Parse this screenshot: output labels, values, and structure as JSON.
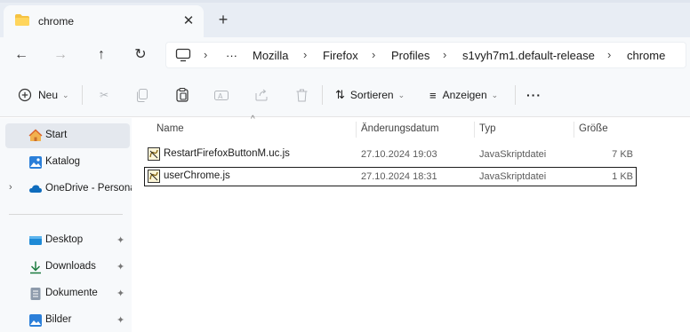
{
  "tab": {
    "title": "chrome",
    "close": "✕",
    "new": "+"
  },
  "nav": {
    "back": "←",
    "forward": "→",
    "up": "↑",
    "refresh": "↻"
  },
  "address": {
    "overflow": "···",
    "crumbs": [
      "Mozilla",
      "Firefox",
      "Profiles",
      "s1vyh7m1.default-release",
      "chrome"
    ],
    "separator": "›"
  },
  "commands": {
    "new_label": "Neu",
    "sort_label": "Sortieren",
    "view_label": "Anzeigen",
    "more": "···"
  },
  "sidebar": {
    "items": [
      {
        "label": "Start",
        "icon": "home-icon"
      },
      {
        "label": "Katalog",
        "icon": "gallery-icon"
      },
      {
        "label": "OneDrive - Persona",
        "icon": "cloud-icon"
      },
      {
        "label": "Desktop",
        "icon": "desktop-icon"
      },
      {
        "label": "Downloads",
        "icon": "download-icon"
      },
      {
        "label": "Dokumente",
        "icon": "document-icon"
      },
      {
        "label": "Bilder",
        "icon": "pictures-icon"
      }
    ],
    "pin": "📌"
  },
  "columns": {
    "name": "Name",
    "date": "Änderungsdatum",
    "type": "Typ",
    "size": "Größe"
  },
  "files": [
    {
      "name": "RestartFirefoxButtonM.uc.js",
      "date": "27.10.2024 19:03",
      "type": "JavaSkriptdatei",
      "size": "7 KB"
    },
    {
      "name": "userChrome.js",
      "date": "27.10.2024 18:31",
      "type": "JavaSkriptdatei",
      "size": "1 KB"
    }
  ],
  "colors": {
    "accent": "#0067c0",
    "folder": "#f5c242"
  }
}
